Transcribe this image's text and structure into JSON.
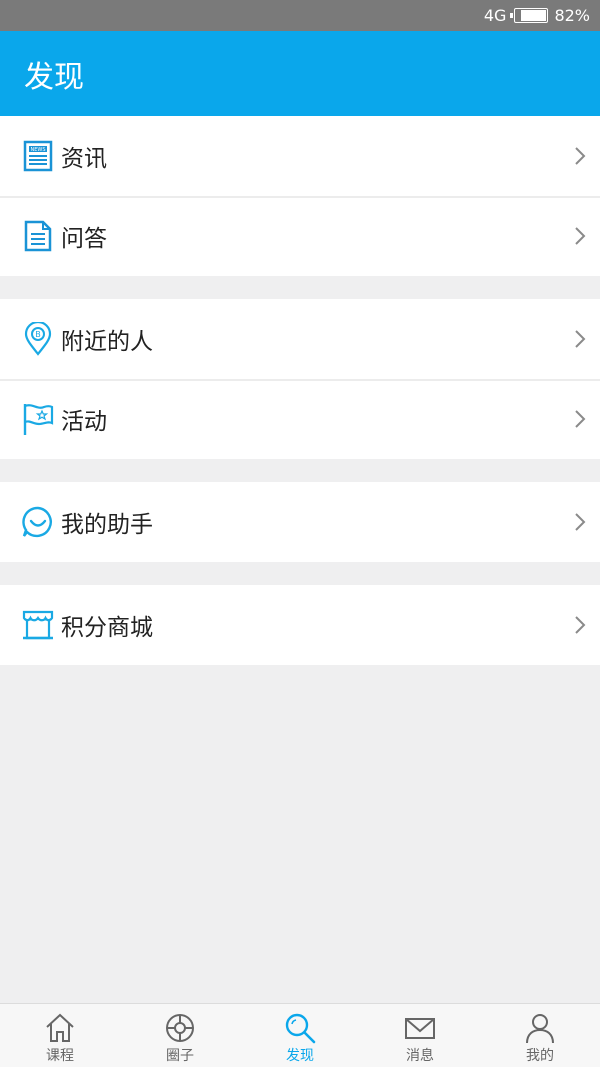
{
  "status_bar": {
    "network": "4G",
    "battery": "82%"
  },
  "header": {
    "title": "发现"
  },
  "groups": [
    [
      {
        "label": "资讯",
        "icon": "news-icon"
      },
      {
        "label": "问答",
        "icon": "document-icon"
      }
    ],
    [
      {
        "label": "附近的人",
        "icon": "location-pin-icon"
      },
      {
        "label": "活动",
        "icon": "flag-icon"
      }
    ],
    [
      {
        "label": "我的助手",
        "icon": "smile-icon"
      }
    ],
    [
      {
        "label": "积分商城",
        "icon": "store-icon"
      }
    ]
  ],
  "tabbar": [
    {
      "label": "课程",
      "icon": "home-icon",
      "active": false
    },
    {
      "label": "圈子",
      "icon": "target-icon",
      "active": false
    },
    {
      "label": "发现",
      "icon": "search-icon",
      "active": true
    },
    {
      "label": "消息",
      "icon": "mail-icon",
      "active": false
    },
    {
      "label": "我的",
      "icon": "person-icon",
      "active": false
    }
  ],
  "colors": {
    "accent": "#0aa7eb",
    "status_bar": "#7a7a7a",
    "background": "#efeff0"
  }
}
